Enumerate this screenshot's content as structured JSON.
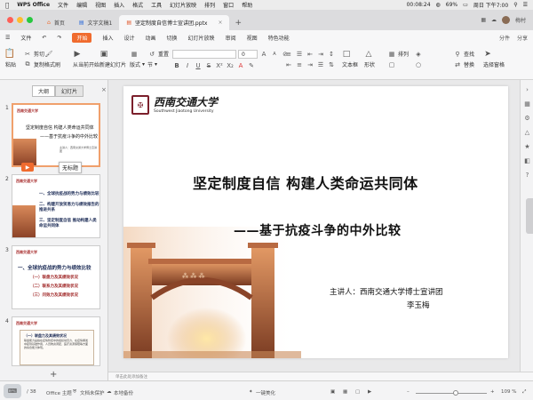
{
  "menubar": {
    "apple": "",
    "app": "WPS Office",
    "items": [
      "文件",
      "编辑",
      "视图",
      "插入",
      "格式",
      "工具",
      "幻灯片放映",
      "排列",
      "窗口",
      "帮助"
    ],
    "battery": "69%",
    "time_small": "00:08:24",
    "clock": "周日 下午7:00"
  },
  "tabs": {
    "home": "首页",
    "doc1": "文字文稿1",
    "active": "坚定制度自信博士宣讲团.pptx",
    "user": "梅村"
  },
  "ribbon_menu": {
    "file": "文件",
    "start": "开始",
    "items": [
      "插入",
      "设计",
      "动画",
      "切换",
      "幻灯片放映",
      "审阅",
      "视图",
      "特色功能"
    ],
    "share_label": "分件",
    "more": "分享"
  },
  "toolbar": {
    "paste": "粘贴",
    "cut": "剪切",
    "copy": "复制",
    "format_painter": "格式刷",
    "play_from_current": "从当前开始",
    "new_slide": "新建幻灯片",
    "layout": "版式",
    "section": "节",
    "reset": "重置",
    "font_name": "",
    "font_size": "0",
    "textbox": "文本框",
    "shape": "形状",
    "arrange": "排列",
    "find": "查找",
    "replace": "替换",
    "select": "选择窗格"
  },
  "panel": {
    "tab_outline": "大纲",
    "tab_slides": "幻灯片",
    "close": "×",
    "tooltip": "无标题",
    "add": "+"
  },
  "thumbs": [
    {
      "num": "1",
      "logo": "西南交通大学",
      "title": "坚定制度自信 构建人类命运共同体",
      "sub": "——基于抗疫斗争的中外比较",
      "sp": "主讲人：西南交通大学博士宣讲团"
    },
    {
      "num": "2",
      "logo": "西南交通大学",
      "items": [
        "一、全球抗疫战的势力与绩效比较",
        "二、构建开放贸易力与绩效报告的推进共系",
        "三、坚定制度自信 推动构建人类命运共同体"
      ]
    },
    {
      "num": "3",
      "logo": "西南交通大学",
      "title": "一、全球抗疫战的势力与绩效比较",
      "bullets": [
        "（一）联盘力及其绩效状况",
        "（二）联系力及其绩效状况",
        "（三）问效力及其绩效状况"
      ]
    },
    {
      "num": "4",
      "logo": "西南交通大学",
      "box_h": "（一）联盘力及其绩效状况",
      "box_b": "联盘能力是指在疫情防控中的组织动员力，在疫情爆发中起到基础作用，人员物资调配，医疗资源保障等方面的综合能力体现。"
    }
  ],
  "slide": {
    "logo_cn": "西南交通大学",
    "logo_en": "Southwest Jiaotong University",
    "title": "坚定制度自信 构建人类命运共同体",
    "subtitle": "——基于抗疫斗争的中外比较",
    "speaker": "主讲人：西南交通大学博士宣讲团",
    "speaker_name": "李玉梅"
  },
  "notes": "单击此处添加备注",
  "status": {
    "slide_pos": "/ 38",
    "theme": "Office 主题",
    "protect": "文档未保护",
    "backup": "本地备份",
    "beautify": "一键美化",
    "zoom": "109 %"
  }
}
